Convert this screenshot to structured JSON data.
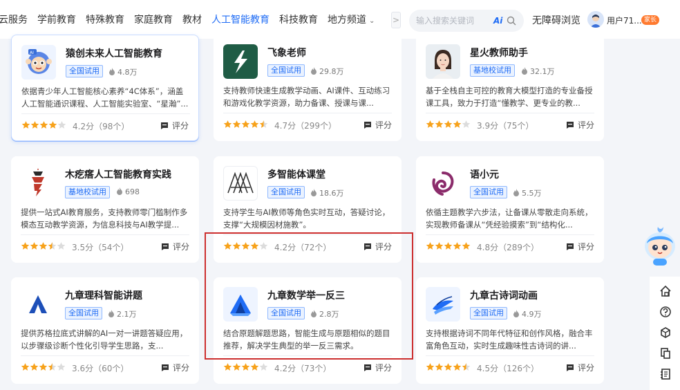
{
  "nav": {
    "items": [
      "云服务",
      "学前教育",
      "特殊教育",
      "家庭教育",
      "教材",
      "人工智能教育",
      "科技教育",
      "地方频道"
    ],
    "active_index": 5,
    "more_arrow": ">",
    "search_placeholder": "输入搜索关键词",
    "ai_badge": "Ai",
    "accessibility": "无障碍浏览",
    "user_name": "用户71...",
    "role_badge": "家长"
  },
  "colors": {
    "accent": "#1f6cf5",
    "star": "#f7a21b",
    "star_empty": "#dcdcdc",
    "highlight": "#cc2e2e"
  },
  "cards": [
    {
      "title": "猿创未来人工智能教育",
      "tag": "全国试用",
      "heat": "4.8万",
      "desc": "依据青少年人工智能核心素养“4C体系”，涵盖人工智能通识课程、人工智能实验室、“星瀚”...",
      "rating": 4.2,
      "score": "4.2分（98个）",
      "rate_label": "评分",
      "logo": "monkey-logo",
      "selected": true
    },
    {
      "title": "飞象老师",
      "tag": "全国试用",
      "heat": "29.8万",
      "desc": "支持教师快速生成教学动画、AI课件、互动练习和游戏化教学资源，助力备课、授课与课...",
      "rating": 4.7,
      "score": "4.7分（299个）",
      "rate_label": "评分",
      "logo": "feixiang-logo"
    },
    {
      "title": "星火教师助手",
      "tag": "基地校试用",
      "heat": "32.1万",
      "desc": "基于全栈自主可控的教育大模型打造的专业备授课工具，致力于打造“懂教学、更专业的教...",
      "rating": 3.9,
      "score": "3.9分（75个）",
      "rate_label": "评分",
      "logo": "teacher-portrait-logo"
    },
    {
      "title": "木疙瘩人工智能教育实践",
      "tag": "基地校试用",
      "heat": "698",
      "desc": "提供一站式AI教育服务，支持教师零门槛制作多模态互动教学资源，为信息科技与AI教学提...",
      "rating": 3.5,
      "score": "3.5分（54个）",
      "rate_label": "评分",
      "logo": "mugeda-logo"
    },
    {
      "title": "多智能体课堂",
      "tag": "全国试用",
      "heat": "18.6万",
      "desc": "支持学生与AI教师等角色实时互动，答疑讨论，支撑“大规模因材施教”。",
      "rating": 4.2,
      "score": "4.2分（72个）",
      "rate_label": "评分",
      "logo": "multi-agent-logo"
    },
    {
      "title": "语小元",
      "tag": "全国试用",
      "heat": "5.5万",
      "desc": "依循主题教学六步法，让备课从零散走向系统，实现教师备课从“凭经验摸索”到“结构化...",
      "rating": 4.8,
      "score": "4.8分（289个）",
      "rate_label": "评分",
      "logo": "yuxiaoyuan-logo"
    },
    {
      "title": "九章理科智能讲题",
      "tag": "全国试用",
      "heat": "2.1万",
      "desc": "提供苏格拉底式讲解的AI一对一讲题答疑应用，以步骤级诊断个性化引导学生思路，支...",
      "rating": 3.6,
      "score": "3.6分（60个）",
      "rate_label": "评分",
      "logo": "jiuzhang-science-logo"
    },
    {
      "title": "九章数学举一反三",
      "tag": "全国试用",
      "heat": "2.8万",
      "desc": "结合原题解题思路，智能生成与原题相似的题目推荐，解决学生典型的举一反三需求。",
      "rating": 4.2,
      "score": "4.2分（73个）",
      "rate_label": "评分",
      "logo": "jiuzhang-math-logo"
    },
    {
      "title": "九章古诗词动画",
      "tag": "全国试用",
      "heat": "4.9万",
      "desc": "支持根据诗词不同年代特征和创作风格，融合丰富角色互动，实时生成趣味性古诗词的讲...",
      "rating": 4.5,
      "score": "4.5分（126个）",
      "rate_label": "评分",
      "logo": "jiuzhang-poetry-logo"
    }
  ],
  "sidebar": {
    "icons": [
      "home-icon",
      "help-icon",
      "cube-icon",
      "copy-icon",
      "notes-icon"
    ]
  }
}
